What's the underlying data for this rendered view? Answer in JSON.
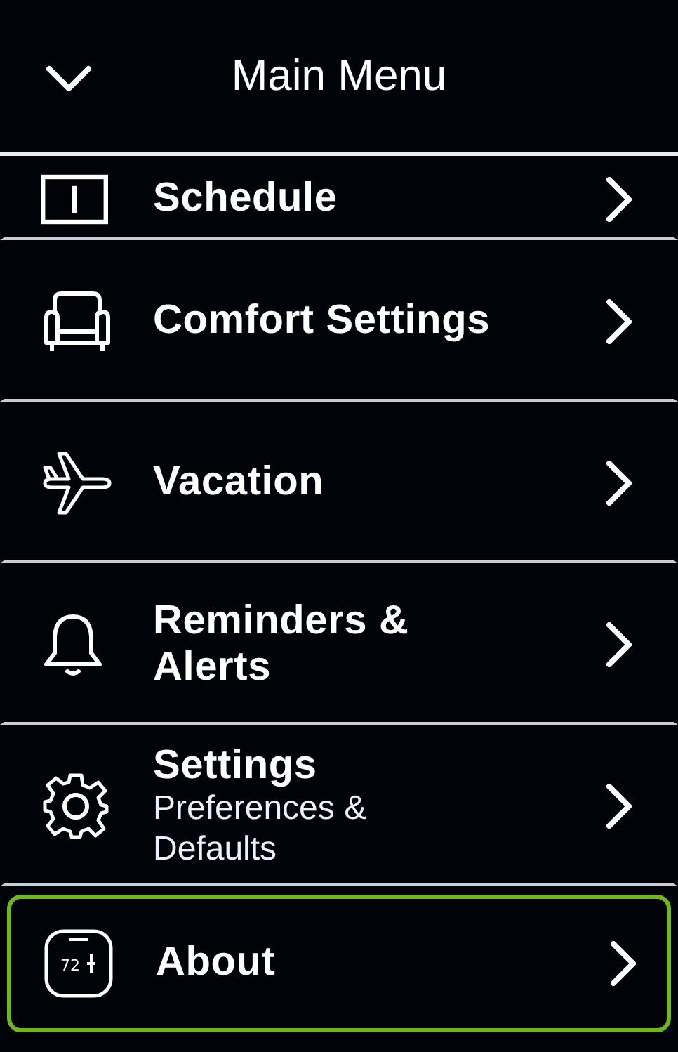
{
  "header": {
    "title": "Main Menu"
  },
  "items": [
    {
      "kind": "calendar",
      "label": "Schedule",
      "selected": false
    },
    {
      "kind": "chair",
      "label": "Comfort Settings",
      "selected": false
    },
    {
      "kind": "plane",
      "label": "Vacation",
      "selected": false
    },
    {
      "kind": "bell",
      "label": "Reminders & Alerts",
      "selected": false
    },
    {
      "kind": "gear",
      "label": "Settings",
      "sublabel": "Preferences & Defaults",
      "selected": false
    },
    {
      "kind": "thermostat",
      "label": "About",
      "icon_text": "72",
      "selected": true
    }
  ]
}
